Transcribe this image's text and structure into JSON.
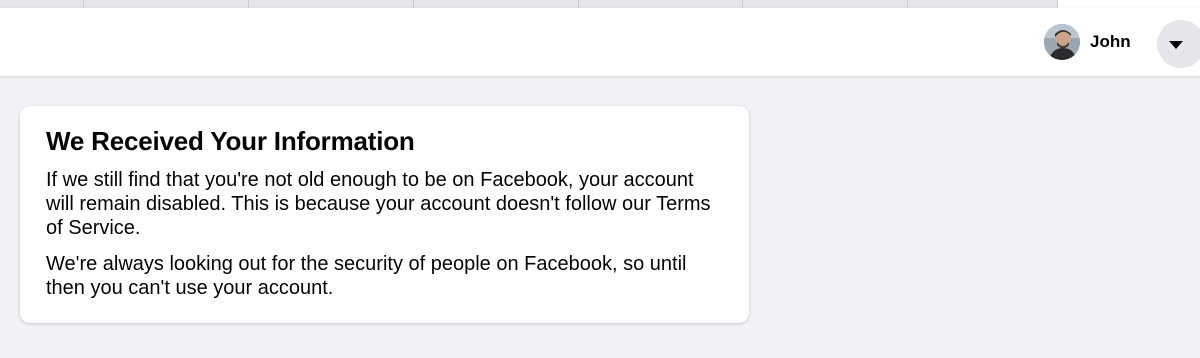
{
  "header": {
    "profile_name": "John",
    "menu_icon": "caret-down-icon",
    "avatar_icon": "avatar"
  },
  "card": {
    "title": "We Received Your Information",
    "paragraph_1": "If we still find that you're not old enough to be on Facebook, your account will remain disabled. This is because your account doesn't follow our Terms of Service.",
    "paragraph_2": "We're always looking out for the security of people on Facebook, so until then you can't use your account."
  },
  "colors": {
    "page_background": "#f0f2f5",
    "card_background": "#ffffff",
    "text": "#050505",
    "menu_button": "#e4e6eb"
  }
}
